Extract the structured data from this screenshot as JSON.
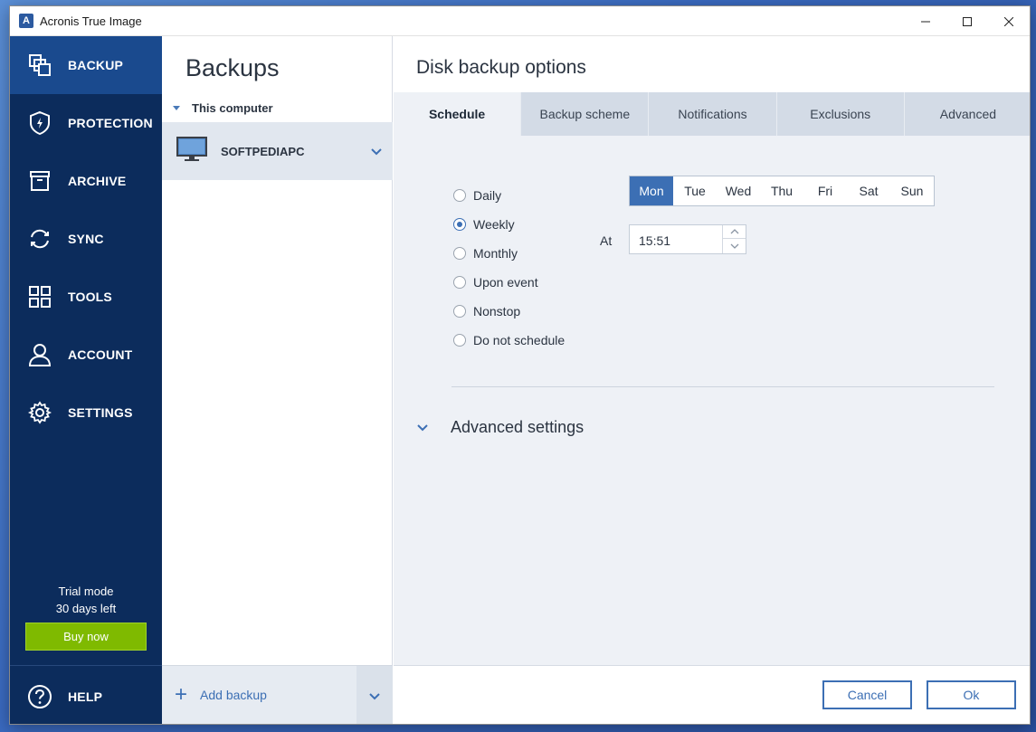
{
  "window": {
    "title": "Acronis True Image",
    "logo_letter": "A"
  },
  "sidebar": {
    "items": [
      {
        "label": "BACKUP",
        "icon": "backup-icon",
        "active": true
      },
      {
        "label": "PROTECTION",
        "icon": "shield-icon",
        "active": false
      },
      {
        "label": "ARCHIVE",
        "icon": "archive-icon",
        "active": false
      },
      {
        "label": "SYNC",
        "icon": "sync-icon",
        "active": false
      },
      {
        "label": "TOOLS",
        "icon": "tools-icon",
        "active": false
      },
      {
        "label": "ACCOUNT",
        "icon": "account-icon",
        "active": false
      },
      {
        "label": "SETTINGS",
        "icon": "gear-icon",
        "active": false
      }
    ],
    "trial_line1": "Trial mode",
    "trial_line2": "30 days left",
    "buy_label": "Buy now",
    "help_label": "HELP"
  },
  "backups": {
    "title": "Backups",
    "group_label": "This computer",
    "item_name": "SOFTPEDIAPC",
    "add_label": "Add backup"
  },
  "options": {
    "title": "Disk backup options",
    "tabs": [
      {
        "label": "Schedule",
        "active": true
      },
      {
        "label": "Backup scheme",
        "active": false
      },
      {
        "label": "Notifications",
        "active": false
      },
      {
        "label": "Exclusions",
        "active": false
      },
      {
        "label": "Advanced",
        "active": false
      }
    ],
    "schedule_options": [
      {
        "label": "Daily",
        "checked": false
      },
      {
        "label": "Weekly",
        "checked": true
      },
      {
        "label": "Monthly",
        "checked": false
      },
      {
        "label": "Upon event",
        "checked": false
      },
      {
        "label": "Nonstop",
        "checked": false
      },
      {
        "label": "Do not schedule",
        "checked": false
      }
    ],
    "days": [
      {
        "label": "Mon",
        "active": true
      },
      {
        "label": "Tue",
        "active": false
      },
      {
        "label": "Wed",
        "active": false
      },
      {
        "label": "Thu",
        "active": false
      },
      {
        "label": "Fri",
        "active": false
      },
      {
        "label": "Sat",
        "active": false
      },
      {
        "label": "Sun",
        "active": false
      }
    ],
    "at_label": "At",
    "time_value": "15:51",
    "advanced_settings_label": "Advanced settings",
    "cancel_label": "Cancel",
    "ok_label": "Ok"
  },
  "colors": {
    "sidebar_bg": "#0c2c5c",
    "sidebar_active": "#1a4a8e",
    "accent": "#3c6fb4",
    "buy_green": "#7fba00"
  }
}
